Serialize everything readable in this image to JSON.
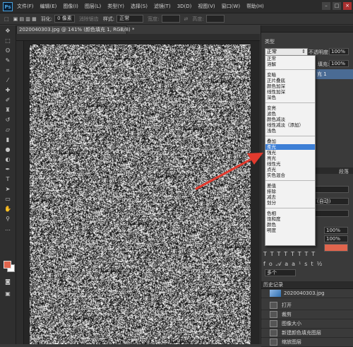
{
  "app": {
    "logo": "Ps"
  },
  "menu": [
    "文件(F)",
    "编辑(E)",
    "图像(I)",
    "图层(L)",
    "类型(Y)",
    "选择(S)",
    "滤镜(T)",
    "3D(D)",
    "视图(V)",
    "窗口(W)",
    "帮助(H)"
  ],
  "window_controls": {
    "minimize": "–",
    "maximize": "□",
    "close": "×"
  },
  "options_bar": {
    "feather_label": "羽化:",
    "feather_value": "0 像素",
    "antialias_label": "消除锯齿",
    "style_label": "样式:",
    "style_value": "正常",
    "width_label": "宽度:",
    "height_label": "高度:"
  },
  "document": {
    "tab_title": "2020040303.jpg @ 141% (颜色填充 1, RGB/8) *"
  },
  "layers_panel": {
    "blend_mode_current": "正常",
    "opacity_label": "不透明度:",
    "opacity_value": "100%",
    "fill_label": "填充:",
    "fill_value": "100%",
    "layer_name_partial": "充 1",
    "filter_label": "类型"
  },
  "blend_modes": {
    "group1": [
      "正常",
      "溶解"
    ],
    "group2": [
      "变暗",
      "正片叠底",
      "颜色加深",
      "线性加深",
      "深色"
    ],
    "group3": [
      "变亮",
      "滤色",
      "颜色减淡",
      "线性减淡（添加）",
      "浅色"
    ],
    "group4": [
      "叠加",
      "柔光",
      "强光",
      "亮光",
      "线性光",
      "点光",
      "实色混合"
    ],
    "group5": [
      "差值",
      "排除",
      "减去",
      "划分"
    ],
    "group6": [
      "色相",
      "饱和度",
      "颜色",
      "明度"
    ],
    "selected": "柔光"
  },
  "side_values": {
    "auto_label": "(自动)",
    "pct1": "100%",
    "pct2": "100%",
    "paragraph_label": "段落",
    "many_label": "多个"
  },
  "history": {
    "title": "历史记录",
    "snapshot": "2020040303.jpg",
    "items": [
      "打开",
      "裁剪",
      "图像大小",
      "新建颜色填充图层",
      "缩放图层"
    ]
  },
  "colors": {
    "foreground": "#e0654d",
    "background": "#ffffff",
    "highlight": "#3d7fd6",
    "arrow": "#e23a2e"
  }
}
